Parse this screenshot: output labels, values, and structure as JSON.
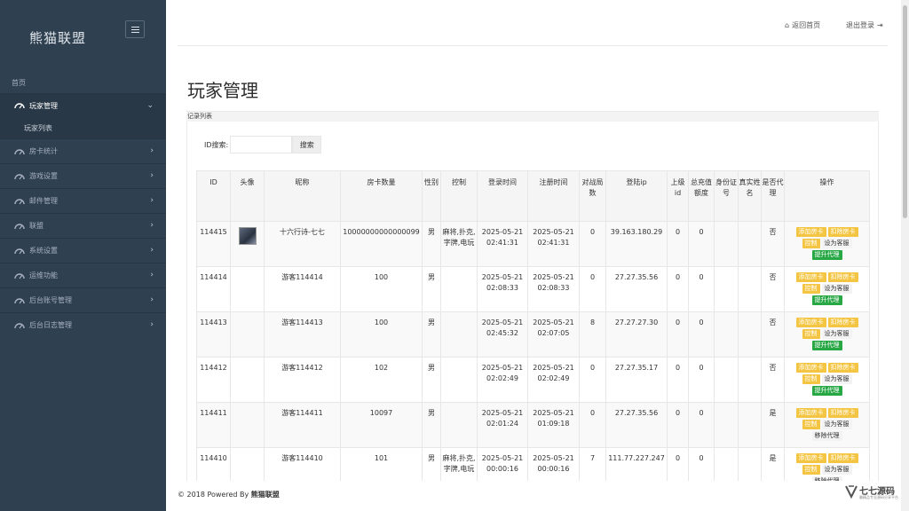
{
  "sidebar": {
    "brand": "熊猫联盟",
    "home": "首页",
    "items": [
      {
        "label": "玩家管理",
        "active": true
      },
      {
        "label": "房卡统计"
      },
      {
        "label": "游戏设置"
      },
      {
        "label": "邮件管理"
      },
      {
        "label": "联盟"
      },
      {
        "label": "系统设置"
      },
      {
        "label": "运维功能"
      },
      {
        "label": "后台账号管理"
      },
      {
        "label": "后台日志管理"
      }
    ],
    "sub_item": "玩家列表"
  },
  "topbar": {
    "home": "返回首页",
    "logout": "退出登录"
  },
  "page": {
    "title": "玩家管理",
    "panel_title": "记录列表",
    "search_label": "ID搜索:",
    "search_value": "",
    "search_button": "搜索"
  },
  "table": {
    "headers": [
      "ID",
      "头像",
      "昵称",
      "房卡数量",
      "性别",
      "控制",
      "登录时间",
      "注册时间",
      "对战局数",
      "登陆ip",
      "上级id",
      "总充值额度",
      "身份证号",
      "真实姓名",
      "是否代理",
      "操作"
    ],
    "rows": [
      {
        "id": "114415",
        "avatar": true,
        "nick": "十六行诗-七七",
        "cards": "10000000000000099",
        "sex": "男",
        "control": "麻将,扑克,字牌,电玩",
        "login": "2025-05-21 02:41:31",
        "reg": "2025-05-21 02:41:31",
        "games": "0",
        "ip": "39.163.180.29",
        "parent": "0",
        "recharge": "0",
        "idcard": "",
        "realname": "",
        "agent": "否",
        "agent_btn": "提升代理"
      },
      {
        "id": "114414",
        "avatar": false,
        "nick": "游客114414",
        "cards": "100",
        "sex": "男",
        "control": "",
        "login": "2025-05-21 02:08:33",
        "reg": "2025-05-21 02:08:33",
        "games": "0",
        "ip": "27.27.35.56",
        "parent": "0",
        "recharge": "0",
        "idcard": "",
        "realname": "",
        "agent": "否",
        "agent_btn": "提升代理"
      },
      {
        "id": "114413",
        "avatar": false,
        "nick": "游客114413",
        "cards": "100",
        "sex": "男",
        "control": "",
        "login": "2025-05-21 02:45:32",
        "reg": "2025-05-21 02:07:05",
        "games": "8",
        "ip": "27.27.27.30",
        "parent": "0",
        "recharge": "0",
        "idcard": "",
        "realname": "",
        "agent": "否",
        "agent_btn": "提升代理"
      },
      {
        "id": "114412",
        "avatar": false,
        "nick": "游客114412",
        "cards": "102",
        "sex": "男",
        "control": "",
        "login": "2025-05-21 02:02:49",
        "reg": "2025-05-21 02:02:49",
        "games": "0",
        "ip": "27.27.35.17",
        "parent": "0",
        "recharge": "0",
        "idcard": "",
        "realname": "",
        "agent": "否",
        "agent_btn": "提升代理"
      },
      {
        "id": "114411",
        "avatar": false,
        "nick": "游客114411",
        "cards": "10097",
        "sex": "男",
        "control": "",
        "login": "2025-05-21 02:01:24",
        "reg": "2025-05-21 01:09:18",
        "games": "0",
        "ip": "27.27.35.56",
        "parent": "0",
        "recharge": "0",
        "idcard": "",
        "realname": "",
        "agent": "是",
        "agent_btn": "移除代理"
      },
      {
        "id": "114410",
        "avatar": false,
        "nick": "游客114410",
        "cards": "101",
        "sex": "男",
        "control": "麻将,扑克,字牌,电玩",
        "login": "2025-05-21 00:00:16",
        "reg": "2025-05-21 00:00:16",
        "games": "7",
        "ip": "111.77.227.247",
        "parent": "0",
        "recharge": "0",
        "idcard": "",
        "realname": "",
        "agent": "是",
        "agent_btn": "移除代理"
      }
    ],
    "op_labels": {
      "add": "添加房卡",
      "deduct": "扣除房卡",
      "control": "控制",
      "service": "设为客服"
    }
  },
  "footer": {
    "prefix": "© 2018 Powered By ",
    "brand": "熊猫联盟"
  },
  "watermark": {
    "text": "七七源码",
    "sub": "最精品专业源码分享平台"
  },
  "colors": {
    "sidebar": "#2f4050",
    "warn_button": "#f4c542",
    "ok_button": "#28a745"
  }
}
